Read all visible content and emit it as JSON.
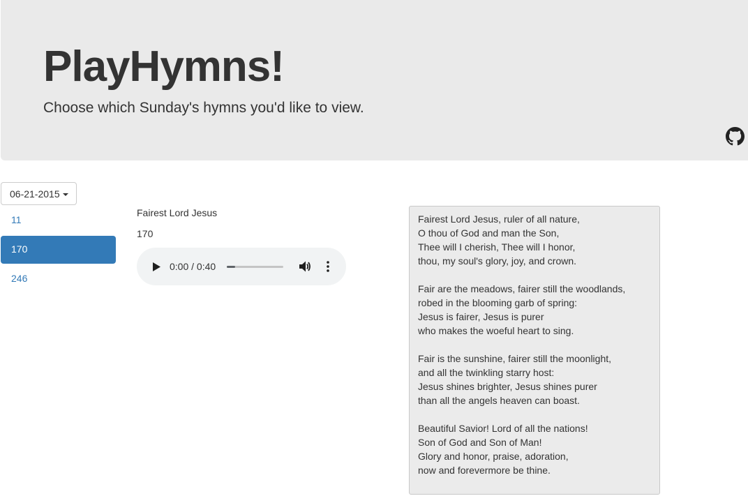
{
  "header": {
    "title": "PlayHymns!",
    "subtitle": "Choose which Sunday's hymns you'd like to view."
  },
  "date_selector": {
    "selected": "06-21-2015"
  },
  "hymn_list": [
    "11",
    "170",
    "246"
  ],
  "selected_hymn": {
    "name": "Fairest Lord Jesus",
    "number": "170"
  },
  "audio": {
    "time": "0:00 / 0:40",
    "progress": 0.15
  },
  "lyrics": [
    [
      "Fairest Lord Jesus, ruler of all nature,",
      "O thou of God and man the Son,",
      "Thee will I cherish, Thee will I honor,",
      "thou, my soul's glory, joy, and crown."
    ],
    [
      "Fair are the meadows, fairer still the woodlands,",
      "robed in the blooming garb of spring:",
      "Jesus is fairer, Jesus is purer",
      "who makes the woeful heart to sing."
    ],
    [
      "Fair is the sunshine, fairer still the moonlight,",
      "and all the twinkling starry host:",
      "Jesus shines brighter, Jesus shines purer",
      "than all the angels heaven can boast."
    ],
    [
      "Beautiful Savior! Lord of all the nations!",
      "Son of God and Son of Man!",
      "Glory and honor, praise, adoration,",
      "now and forevermore be thine."
    ]
  ],
  "colors": {
    "accent": "#337ab7",
    "jumbotron": "#eaeaea"
  },
  "icons": [
    "github-icon",
    "play-icon",
    "volume-icon",
    "more-options-icon",
    "caret-down-icon"
  ]
}
